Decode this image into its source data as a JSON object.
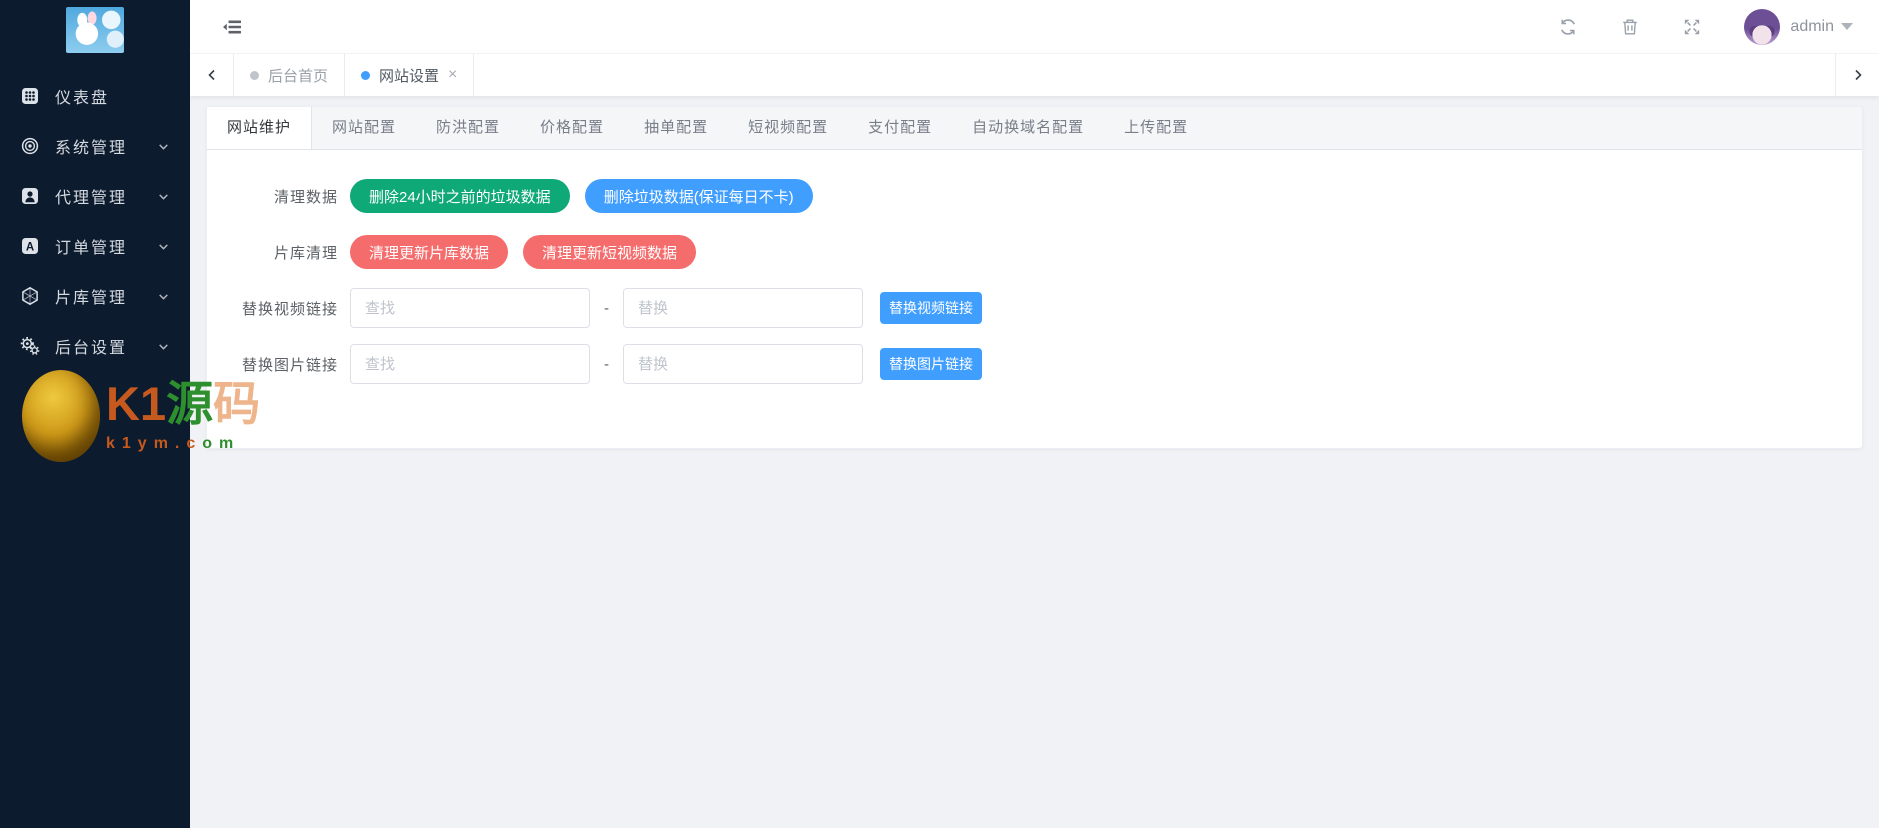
{
  "colors": {
    "accent": "#409eff",
    "success_button": "#0fa877",
    "danger_button": "#f56c6c",
    "sidebar_bg": "#0c1b2e",
    "content_bg": "#f0f2f5"
  },
  "sidebar": {
    "items": [
      {
        "icon": "dashboard-icon",
        "label": "仪表盘",
        "has_submenu": false
      },
      {
        "icon": "system-manage-icon",
        "label": "系统管理",
        "has_submenu": true
      },
      {
        "icon": "agent-manage-icon",
        "label": "代理管理",
        "has_submenu": true
      },
      {
        "icon": "order-manage-icon",
        "label": "订单管理",
        "has_submenu": true
      },
      {
        "icon": "library-manage-icon",
        "label": "片库管理",
        "has_submenu": true
      },
      {
        "icon": "backend-settings-icon",
        "label": "后台设置",
        "has_submenu": true
      }
    ],
    "watermark": {
      "brand_k1": "K1",
      "brand_yuan": "源",
      "brand_ma": "码",
      "domain_left": "k1ym.c",
      "domain_right": "om"
    }
  },
  "topbar": {
    "icons": [
      "menu-fold-icon",
      "refresh-icon",
      "trash-icon",
      "fullscreen-icon"
    ],
    "username": "admin"
  },
  "tagbar": {
    "tabs": [
      {
        "label": "后台首页",
        "active": false
      },
      {
        "label": "网站设置",
        "active": true,
        "close_glyph": "×"
      }
    ]
  },
  "main": {
    "tabs": [
      {
        "label": "网站维护",
        "active": true
      },
      {
        "label": "网站配置",
        "active": false
      },
      {
        "label": "防洪配置",
        "active": false
      },
      {
        "label": "价格配置",
        "active": false
      },
      {
        "label": "抽单配置",
        "active": false
      },
      {
        "label": "短视频配置",
        "active": false
      },
      {
        "label": "支付配置",
        "active": false
      },
      {
        "label": "自动换域名配置",
        "active": false
      },
      {
        "label": "上传配置",
        "active": false
      }
    ],
    "form": {
      "clean_data": {
        "label": "清理数据",
        "btn_green": "删除24小时之前的垃圾数据",
        "btn_blue": "删除垃圾数据(保证每日不卡)"
      },
      "library_clean": {
        "label": "片库清理",
        "btn_film": "清理更新片库数据",
        "btn_short_video": "清理更新短视频数据"
      },
      "replace_video": {
        "label": "替换视频链接",
        "find_placeholder": "查找",
        "separator": "-",
        "replace_placeholder": "替换",
        "btn": "替换视频链接"
      },
      "replace_image": {
        "label": "替换图片链接",
        "find_placeholder": "查找",
        "separator": "-",
        "replace_placeholder": "替换",
        "btn": "替换图片链接"
      }
    }
  }
}
